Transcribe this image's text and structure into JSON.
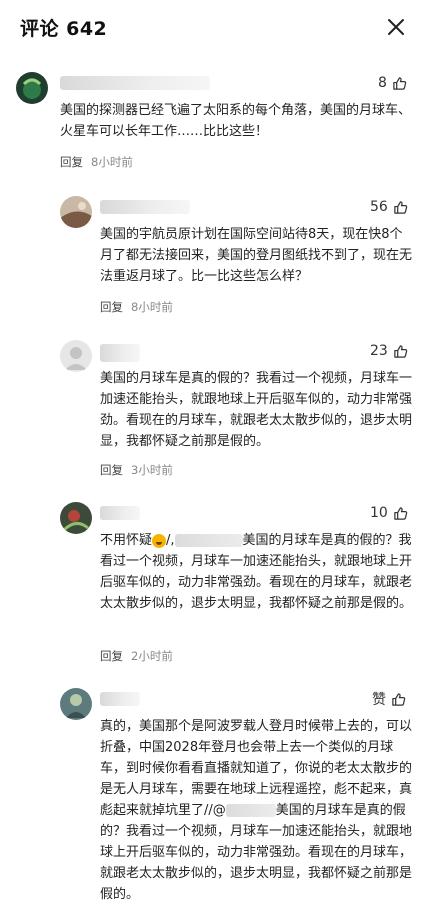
{
  "header": {
    "title": "评论 642"
  },
  "comments": [
    {
      "likes": "8",
      "text": "美国的探测器已经飞遍了太阳系的每个角落，美国的月球车、火星车可以长年工作……比比这些！",
      "reply_label": "回复",
      "time": "8小时前"
    },
    {
      "likes": "56",
      "text": "美国的宇航员原计划在国际空间站待8天，现在快8个月了都无法接回来，美国的登月图纸找不到了，现在无法重返月球了。比一比这些怎么样？",
      "reply_label": "回复",
      "time": "8小时前"
    },
    {
      "likes": "23",
      "text": "美国的月球车是真的假的？我看过一个视频，月球车一加速还能抬头，就跟地球上开后驱车似的，动力非常强劲。看现在的月球车，就跟老太太散步似的，退步太明显，我都怀疑之前那是假的。",
      "reply_label": "回复",
      "time": "3小时前"
    },
    {
      "likes": "10",
      "text_prefix": "不用怀疑",
      "text_mid": "/,",
      "text_quote": "美国的月球车是真的假的？我看过一个视频，月球车一加速还能抬头，就跟地球上开后驱车似的，动力非常强劲。看现在的月球车，就跟老太太散步似的，退步太明显，我都怀疑之前那是假的。",
      "reply_label": "回复",
      "time": "2小时前"
    },
    {
      "likes": "赞",
      "text": "真的，美国那个是阿波罗载人登月时候带上去的，可以折叠，中国2028年登月也会带上去一个类似的月球车，到时候你看看直播就知道了，你说的老太太散步的是无人月球车，需要在地球上远程遥控，彪不起来，真彪起来就掉坑里了//@",
      "text_quote": "美国的月球车是真的假的？我看过一个视频，月球车一加速还能抬头，就跟地球上开后驱车似的，动力非常强劲。看现在的月球车，就跟老太太散步似的，退步太明显，我都怀疑之前那是假的。"
    }
  ]
}
